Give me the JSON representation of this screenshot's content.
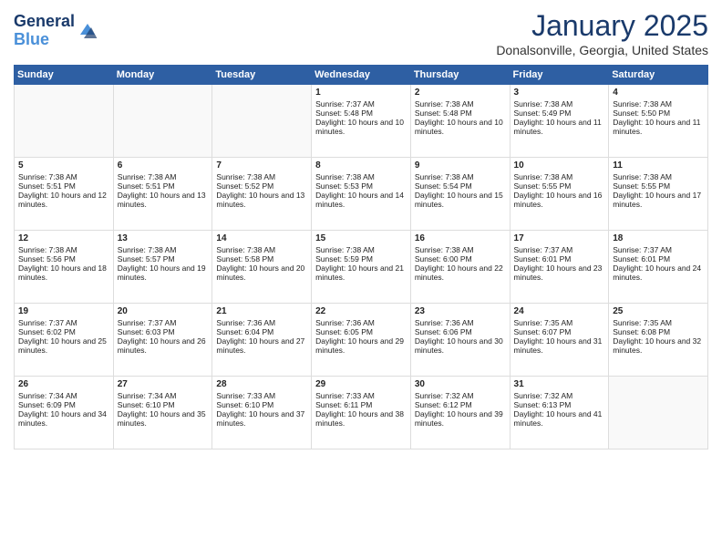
{
  "header": {
    "logo_line1": "General",
    "logo_line2": "Blue",
    "title": "January 2025",
    "subtitle": "Donalsonville, Georgia, United States"
  },
  "days_of_week": [
    "Sunday",
    "Monday",
    "Tuesday",
    "Wednesday",
    "Thursday",
    "Friday",
    "Saturday"
  ],
  "weeks": [
    [
      {
        "day": "",
        "sunrise": "",
        "sunset": "",
        "daylight": ""
      },
      {
        "day": "",
        "sunrise": "",
        "sunset": "",
        "daylight": ""
      },
      {
        "day": "",
        "sunrise": "",
        "sunset": "",
        "daylight": ""
      },
      {
        "day": "1",
        "sunrise": "Sunrise: 7:37 AM",
        "sunset": "Sunset: 5:48 PM",
        "daylight": "Daylight: 10 hours and 10 minutes."
      },
      {
        "day": "2",
        "sunrise": "Sunrise: 7:38 AM",
        "sunset": "Sunset: 5:48 PM",
        "daylight": "Daylight: 10 hours and 10 minutes."
      },
      {
        "day": "3",
        "sunrise": "Sunrise: 7:38 AM",
        "sunset": "Sunset: 5:49 PM",
        "daylight": "Daylight: 10 hours and 11 minutes."
      },
      {
        "day": "4",
        "sunrise": "Sunrise: 7:38 AM",
        "sunset": "Sunset: 5:50 PM",
        "daylight": "Daylight: 10 hours and 11 minutes."
      }
    ],
    [
      {
        "day": "5",
        "sunrise": "Sunrise: 7:38 AM",
        "sunset": "Sunset: 5:51 PM",
        "daylight": "Daylight: 10 hours and 12 minutes."
      },
      {
        "day": "6",
        "sunrise": "Sunrise: 7:38 AM",
        "sunset": "Sunset: 5:51 PM",
        "daylight": "Daylight: 10 hours and 13 minutes."
      },
      {
        "day": "7",
        "sunrise": "Sunrise: 7:38 AM",
        "sunset": "Sunset: 5:52 PM",
        "daylight": "Daylight: 10 hours and 13 minutes."
      },
      {
        "day": "8",
        "sunrise": "Sunrise: 7:38 AM",
        "sunset": "Sunset: 5:53 PM",
        "daylight": "Daylight: 10 hours and 14 minutes."
      },
      {
        "day": "9",
        "sunrise": "Sunrise: 7:38 AM",
        "sunset": "Sunset: 5:54 PM",
        "daylight": "Daylight: 10 hours and 15 minutes."
      },
      {
        "day": "10",
        "sunrise": "Sunrise: 7:38 AM",
        "sunset": "Sunset: 5:55 PM",
        "daylight": "Daylight: 10 hours and 16 minutes."
      },
      {
        "day": "11",
        "sunrise": "Sunrise: 7:38 AM",
        "sunset": "Sunset: 5:55 PM",
        "daylight": "Daylight: 10 hours and 17 minutes."
      }
    ],
    [
      {
        "day": "12",
        "sunrise": "Sunrise: 7:38 AM",
        "sunset": "Sunset: 5:56 PM",
        "daylight": "Daylight: 10 hours and 18 minutes."
      },
      {
        "day": "13",
        "sunrise": "Sunrise: 7:38 AM",
        "sunset": "Sunset: 5:57 PM",
        "daylight": "Daylight: 10 hours and 19 minutes."
      },
      {
        "day": "14",
        "sunrise": "Sunrise: 7:38 AM",
        "sunset": "Sunset: 5:58 PM",
        "daylight": "Daylight: 10 hours and 20 minutes."
      },
      {
        "day": "15",
        "sunrise": "Sunrise: 7:38 AM",
        "sunset": "Sunset: 5:59 PM",
        "daylight": "Daylight: 10 hours and 21 minutes."
      },
      {
        "day": "16",
        "sunrise": "Sunrise: 7:38 AM",
        "sunset": "Sunset: 6:00 PM",
        "daylight": "Daylight: 10 hours and 22 minutes."
      },
      {
        "day": "17",
        "sunrise": "Sunrise: 7:37 AM",
        "sunset": "Sunset: 6:01 PM",
        "daylight": "Daylight: 10 hours and 23 minutes."
      },
      {
        "day": "18",
        "sunrise": "Sunrise: 7:37 AM",
        "sunset": "Sunset: 6:01 PM",
        "daylight": "Daylight: 10 hours and 24 minutes."
      }
    ],
    [
      {
        "day": "19",
        "sunrise": "Sunrise: 7:37 AM",
        "sunset": "Sunset: 6:02 PM",
        "daylight": "Daylight: 10 hours and 25 minutes."
      },
      {
        "day": "20",
        "sunrise": "Sunrise: 7:37 AM",
        "sunset": "Sunset: 6:03 PM",
        "daylight": "Daylight: 10 hours and 26 minutes."
      },
      {
        "day": "21",
        "sunrise": "Sunrise: 7:36 AM",
        "sunset": "Sunset: 6:04 PM",
        "daylight": "Daylight: 10 hours and 27 minutes."
      },
      {
        "day": "22",
        "sunrise": "Sunrise: 7:36 AM",
        "sunset": "Sunset: 6:05 PM",
        "daylight": "Daylight: 10 hours and 29 minutes."
      },
      {
        "day": "23",
        "sunrise": "Sunrise: 7:36 AM",
        "sunset": "Sunset: 6:06 PM",
        "daylight": "Daylight: 10 hours and 30 minutes."
      },
      {
        "day": "24",
        "sunrise": "Sunrise: 7:35 AM",
        "sunset": "Sunset: 6:07 PM",
        "daylight": "Daylight: 10 hours and 31 minutes."
      },
      {
        "day": "25",
        "sunrise": "Sunrise: 7:35 AM",
        "sunset": "Sunset: 6:08 PM",
        "daylight": "Daylight: 10 hours and 32 minutes."
      }
    ],
    [
      {
        "day": "26",
        "sunrise": "Sunrise: 7:34 AM",
        "sunset": "Sunset: 6:09 PM",
        "daylight": "Daylight: 10 hours and 34 minutes."
      },
      {
        "day": "27",
        "sunrise": "Sunrise: 7:34 AM",
        "sunset": "Sunset: 6:10 PM",
        "daylight": "Daylight: 10 hours and 35 minutes."
      },
      {
        "day": "28",
        "sunrise": "Sunrise: 7:33 AM",
        "sunset": "Sunset: 6:10 PM",
        "daylight": "Daylight: 10 hours and 37 minutes."
      },
      {
        "day": "29",
        "sunrise": "Sunrise: 7:33 AM",
        "sunset": "Sunset: 6:11 PM",
        "daylight": "Daylight: 10 hours and 38 minutes."
      },
      {
        "day": "30",
        "sunrise": "Sunrise: 7:32 AM",
        "sunset": "Sunset: 6:12 PM",
        "daylight": "Daylight: 10 hours and 39 minutes."
      },
      {
        "day": "31",
        "sunrise": "Sunrise: 7:32 AM",
        "sunset": "Sunset: 6:13 PM",
        "daylight": "Daylight: 10 hours and 41 minutes."
      },
      {
        "day": "",
        "sunrise": "",
        "sunset": "",
        "daylight": ""
      }
    ]
  ]
}
